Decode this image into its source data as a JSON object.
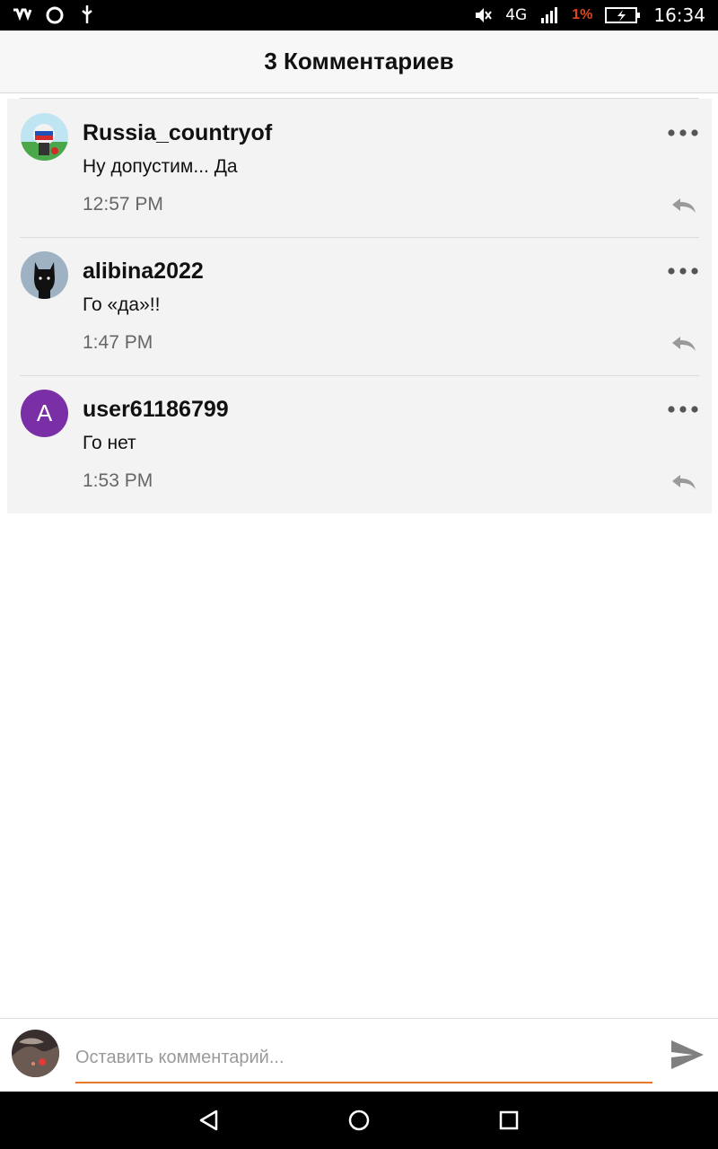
{
  "status_bar": {
    "network": "4G",
    "battery_percent": "1%",
    "time": "16:34"
  },
  "header": {
    "title": "3 Комментариев"
  },
  "comments": [
    {
      "username": "Russia_countryof",
      "text": "Ну допустим... Да",
      "time": "12:57 PM",
      "avatar": "flag-avatar"
    },
    {
      "username": "alibina2022",
      "text": "Го «да»!!",
      "time": "1:47 PM",
      "avatar": "cat-silhouette-avatar"
    },
    {
      "username": "user61186799",
      "text": "Го нет",
      "time": "1:53 PM",
      "avatar_letter": "A",
      "avatar_color": "#7b2fa7"
    }
  ],
  "input": {
    "placeholder": "Оставить комментарий..."
  },
  "colors": {
    "accent": "#e8772e",
    "battery_low": "#e0461a"
  }
}
